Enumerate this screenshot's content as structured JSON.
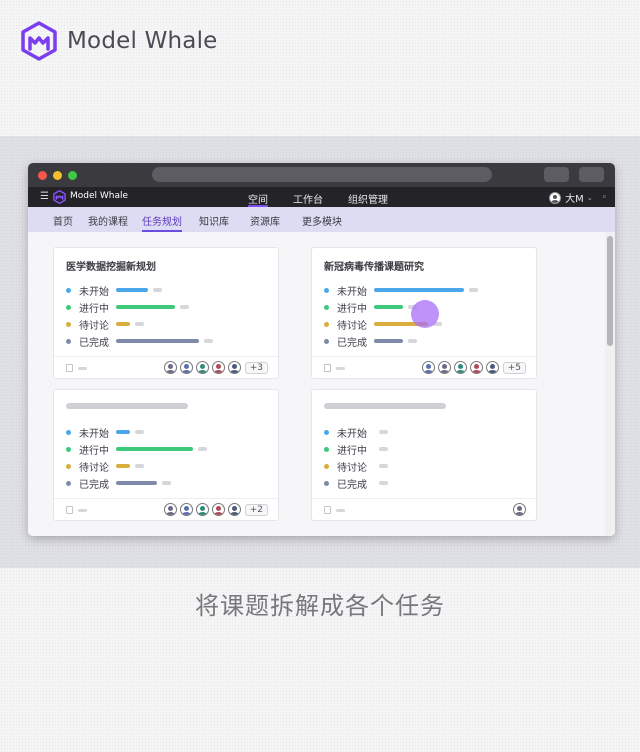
{
  "brand": {
    "name": "Model Whale"
  },
  "colors": {
    "accent": "#6b4ee0",
    "not_started": "#4aa7e9",
    "in_progress": "#3ec97a",
    "discuss": "#d9ad3e",
    "done": "#7e8aa8"
  },
  "app": {
    "brand": "Model Whale",
    "menu_icon": "hamburger-icon",
    "top_nav": [
      {
        "label": "空间",
        "active": true
      },
      {
        "label": "工作台",
        "active": false
      },
      {
        "label": "组织管理",
        "active": false
      }
    ],
    "user": {
      "name": "大M"
    },
    "sub_nav": [
      {
        "label": "首页",
        "active": false
      },
      {
        "label": "我的课程",
        "active": false
      },
      {
        "label": "任务规划",
        "active": true
      },
      {
        "label": "知识库",
        "active": false
      },
      {
        "label": "资源库",
        "active": false
      },
      {
        "label": "更多模块",
        "active": false
      }
    ]
  },
  "status_labels": [
    "未开始",
    "进行中",
    "待讨论",
    "已完成"
  ],
  "cards": [
    {
      "title": "医学数据挖掘新规划",
      "progress": [
        0.36,
        0.66,
        0.16,
        0.92
      ],
      "more_members": "+3"
    },
    {
      "title": "新冠病毒传播课题研究",
      "progress": [
        1.0,
        0.32,
        0.6,
        0.32
      ],
      "more_members": "+5"
    },
    {
      "title": "",
      "progress": [
        0.16,
        0.86,
        0.16,
        0.46
      ],
      "more_members": "+2"
    },
    {
      "title": "",
      "progress": [
        0.0,
        0.0,
        0.0,
        0.0
      ],
      "more_members": ""
    }
  ],
  "caption": "将课题拆解成各个任务"
}
